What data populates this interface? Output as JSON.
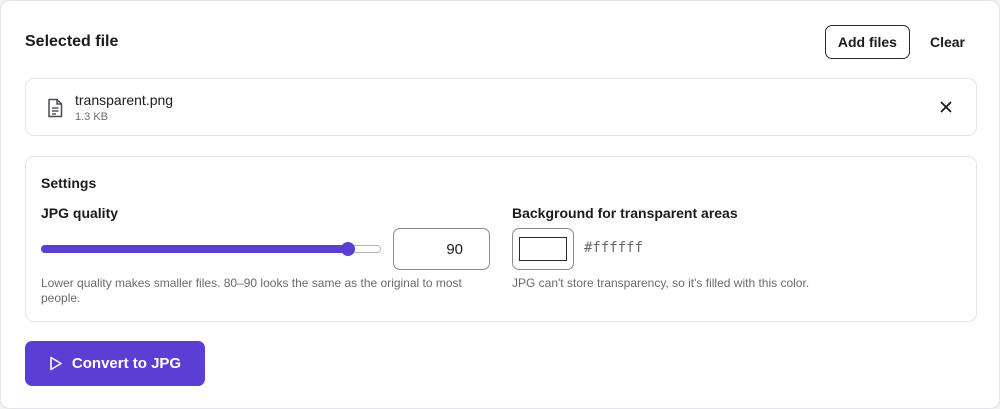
{
  "header": {
    "title": "Selected file",
    "add_files_label": "Add files",
    "clear_label": "Clear"
  },
  "file": {
    "name": "transparent.png",
    "size": "1.3 KB",
    "icon": "document-icon",
    "remove_icon": "close-icon"
  },
  "settings": {
    "title": "Settings",
    "quality": {
      "label": "JPG quality",
      "value": "90",
      "min": 0,
      "max": 100,
      "help": "Lower quality makes smaller files. 80–90 looks the same as the original to most people."
    },
    "background": {
      "label": "Background for transparent areas",
      "color": "#ffffff",
      "hex_text": "#ffffff",
      "help": "JPG can't store transparency, so it's filled with this color."
    }
  },
  "convert": {
    "label": "Convert to JPG",
    "icon": "play-icon"
  },
  "colors": {
    "accent": "#5b3fd4",
    "border": "#e4e4e8",
    "muted_text": "#6a6a73"
  }
}
